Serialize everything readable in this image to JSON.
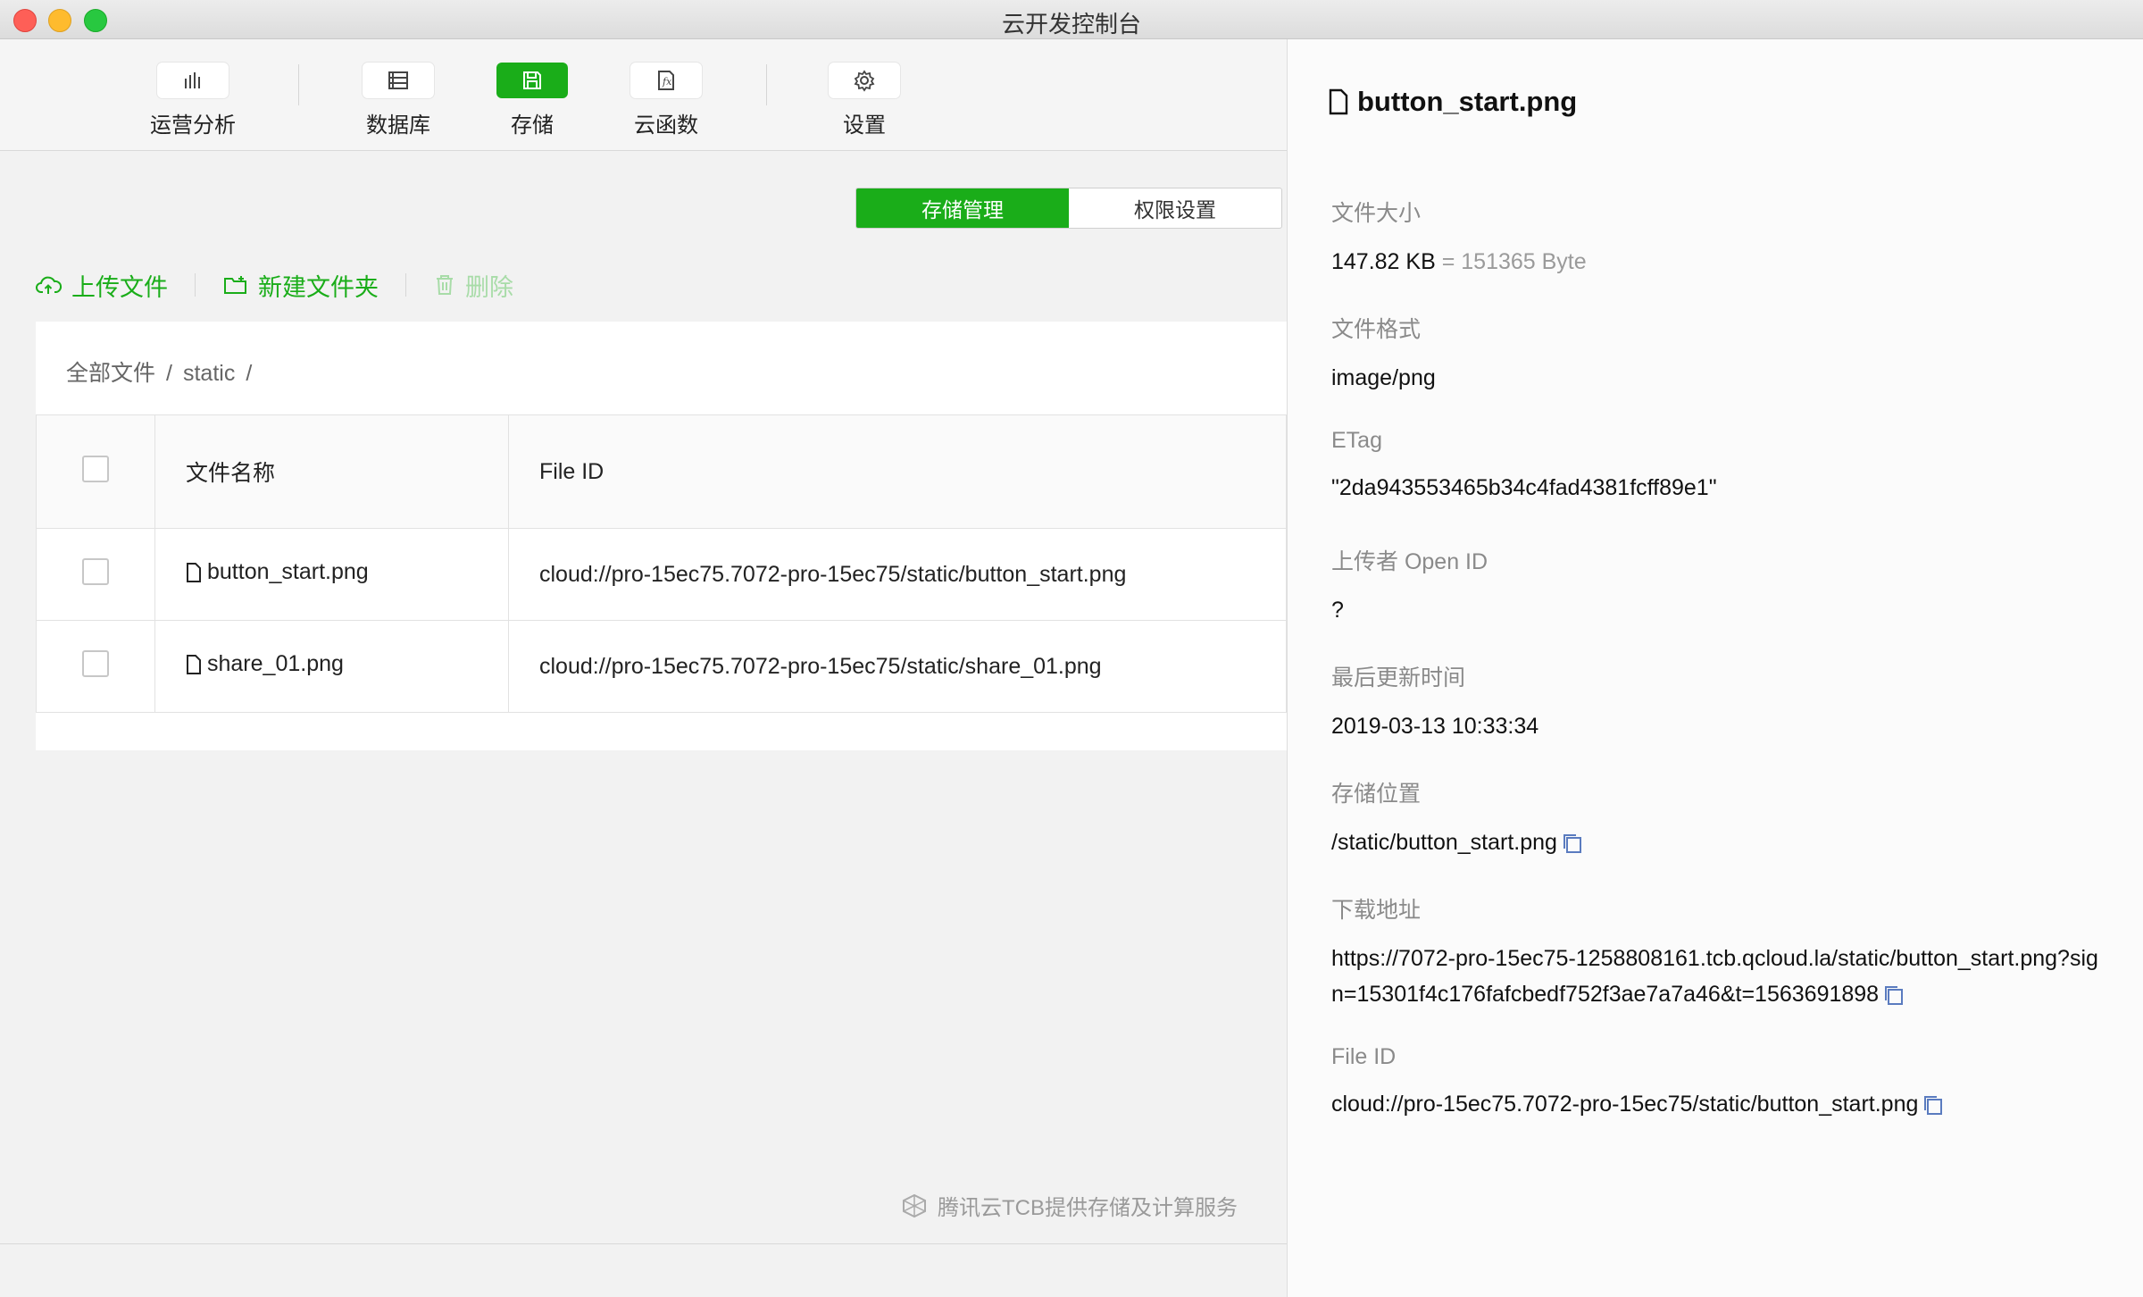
{
  "window": {
    "title": "云开发控制台"
  },
  "toolbar": {
    "items": [
      {
        "label": "运营分析",
        "icon": "bar-chart-icon"
      },
      {
        "label": "数据库",
        "icon": "database-icon"
      },
      {
        "label": "存储",
        "icon": "storage-icon",
        "active": true
      },
      {
        "label": "云函数",
        "icon": "function-icon"
      },
      {
        "label": "设置",
        "icon": "gear-icon"
      }
    ]
  },
  "tabs": {
    "storage_manage": "存储管理",
    "permissions": "权限设置"
  },
  "actions": {
    "upload": "上传文件",
    "new_folder": "新建文件夹",
    "delete": "删除"
  },
  "breadcrumb": {
    "root": "全部文件",
    "sep1": "/",
    "folder": "static",
    "sep2": "/"
  },
  "table": {
    "headers": {
      "name": "文件名称",
      "file_id": "File ID"
    },
    "rows": [
      {
        "name": "button_start.png",
        "file_id": "cloud://pro-15ec75.7072-pro-15ec75/static/button_start.png"
      },
      {
        "name": "share_01.png",
        "file_id": "cloud://pro-15ec75.7072-pro-15ec75/static/share_01.png"
      }
    ]
  },
  "footer": {
    "brand": "腾讯云TCB提供存储及计算服务"
  },
  "detail": {
    "title": "button_start.png",
    "size_label": "文件大小",
    "size_value": "147.82 KB",
    "size_bytes": "= 151365 Byte",
    "format_label": "文件格式",
    "format_value": "image/png",
    "etag_label": "ETag",
    "etag_value": "\"2da943553465b34c4fad4381fcff89e1\"",
    "uploader_label": "上传者 Open ID",
    "uploader_value": "?",
    "updated_label": "最后更新时间",
    "updated_value": "2019-03-13 10:33:34",
    "location_label": "存储位置",
    "location_value": "/static/button_start.png",
    "download_label": "下载地址",
    "download_value": "https://7072-pro-15ec75-1258808161.tcb.qcloud.la/static/button_start.png?sign=15301f4c176fafcbedf752f3ae7a7a46&t=1563691898",
    "fileid_label": "File ID",
    "fileid_value": "cloud://pro-15ec75.7072-pro-15ec75/static/button_start.png"
  },
  "colors": {
    "accent": "#1aad19"
  }
}
